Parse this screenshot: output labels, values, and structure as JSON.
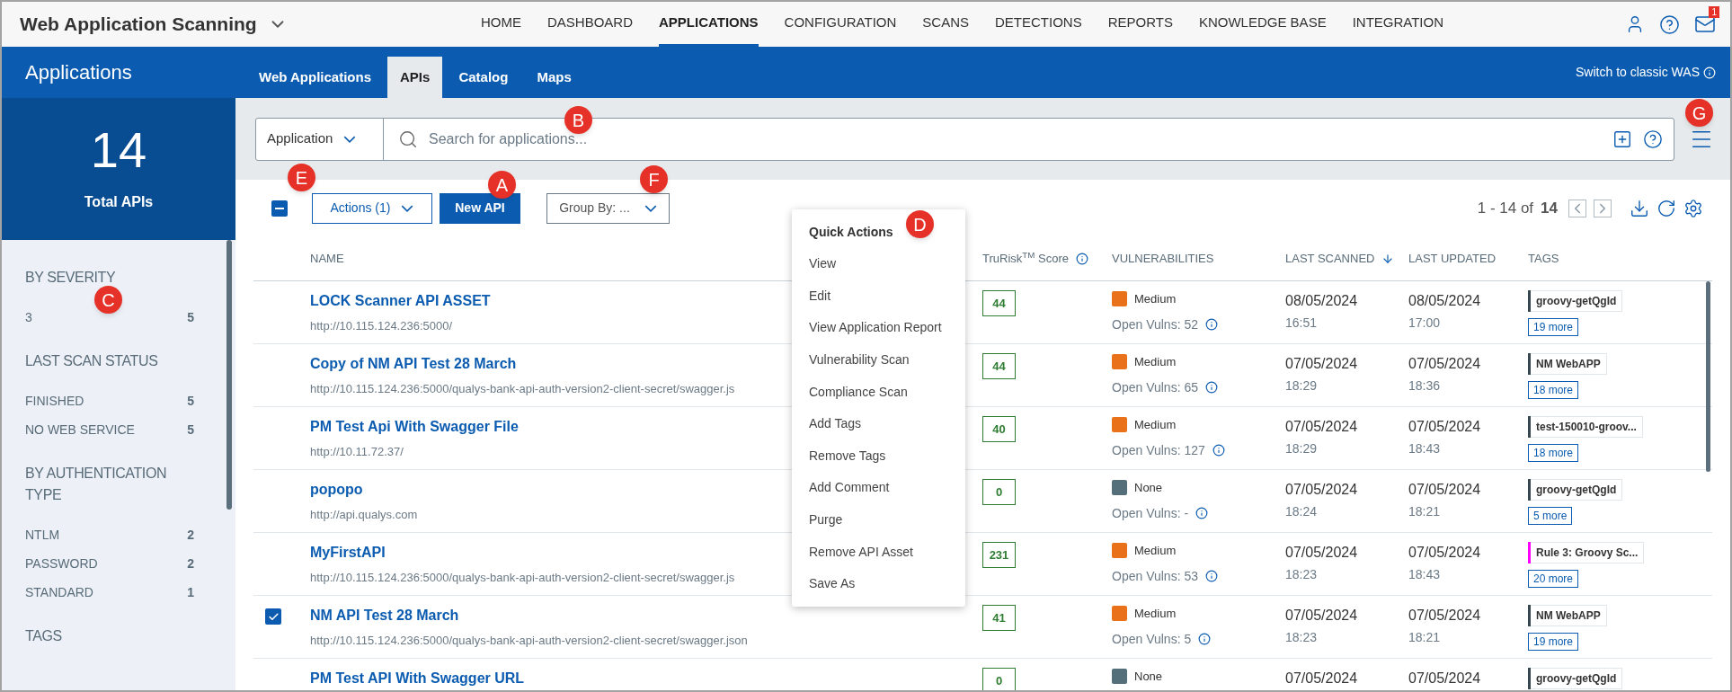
{
  "app_title": "Web Application Scanning",
  "nav": [
    {
      "label": "HOME",
      "selected": false
    },
    {
      "label": "DASHBOARD",
      "selected": false
    },
    {
      "label": "APPLICATIONS",
      "selected": true
    },
    {
      "label": "CONFIGURATION",
      "selected": false
    },
    {
      "label": "SCANS",
      "selected": false
    },
    {
      "label": "DETECTIONS",
      "selected": false
    },
    {
      "label": "REPORTS",
      "selected": false
    },
    {
      "label": "KNOWLEDGE BASE",
      "selected": false
    },
    {
      "label": "INTEGRATION",
      "selected": false
    }
  ],
  "notification_count": "1",
  "section_title": "Applications",
  "tabs": [
    {
      "label": "Web Applications",
      "selected": false
    },
    {
      "label": "APIs",
      "selected": true
    },
    {
      "label": "Catalog",
      "selected": false
    },
    {
      "label": "Maps",
      "selected": false
    }
  ],
  "switch_link": "Switch to classic WAS",
  "summary": {
    "count": "14",
    "label": "Total APIs"
  },
  "filters": [
    {
      "heading": "BY SEVERITY",
      "items": [
        {
          "label": "3",
          "count": "5"
        }
      ]
    },
    {
      "heading": "LAST SCAN STATUS",
      "items": [
        {
          "label": "FINISHED",
          "count": "5"
        },
        {
          "label": "NO WEB SERVICE",
          "count": "5"
        }
      ]
    },
    {
      "heading": "BY AUTHENTICATION TYPE",
      "items": [
        {
          "label": "NTLM",
          "count": "2"
        },
        {
          "label": "PASSWORD",
          "count": "2"
        },
        {
          "label": "STANDARD",
          "count": "1"
        }
      ]
    },
    {
      "heading": "TAGS"
    }
  ],
  "search": {
    "scope": "Application",
    "placeholder": "Search for applications..."
  },
  "toolbar": {
    "select_all_partial": true,
    "actions": "Actions (1)",
    "new_button": "New API",
    "group_by": "Group By: ...",
    "range": "1 - 14 of",
    "total": "14"
  },
  "columns": [
    {
      "label": "NAME",
      "sorted": false,
      "info": false
    },
    {
      "label": "TruRisk$^{TM}$ Score",
      "sorted": false,
      "info": true
    },
    {
      "label": "VULNERABILITIES",
      "sorted": false,
      "info": false
    },
    {
      "label": "LAST SCANNED",
      "sorted": true,
      "info": false
    },
    {
      "label": "LAST UPDATED",
      "sorted": false,
      "info": false
    },
    {
      "label": "TAGS",
      "sorted": false,
      "info": false
    }
  ],
  "rows": [
    {
      "checked": false,
      "name": "LOCK Scanner API ASSET",
      "url": "http://10.115.124.236:5000/",
      "score": "44",
      "severity": "Medium",
      "color": "#e8711a",
      "open_vulns": "Open Vulns: 52",
      "scanned_date": "08/05/2024",
      "scanned_time": "16:51",
      "updated_date": "08/05/2024",
      "updated_time": "17:00",
      "tag": {
        "label": "groovy-getQgId",
        "color": "#37474f"
      },
      "more": "19 more"
    },
    {
      "checked": false,
      "name": "Copy of NM API Test 28 March",
      "url": "http://10.115.124.236:5000/qualys-bank-api-auth-version2-client-secret/swagger.js",
      "score": "44",
      "severity": "Medium",
      "color": "#e8711a",
      "open_vulns": "Open Vulns: 65",
      "scanned_date": "07/05/2024",
      "scanned_time": "18:29",
      "updated_date": "07/05/2024",
      "updated_time": "18:36",
      "tag": {
        "label": "NM WebAPP",
        "color": "#37474f"
      },
      "more": "18 more"
    },
    {
      "checked": false,
      "name": "PM Test Api With Swagger File",
      "url": "http://10.11.72.37/",
      "score": "40",
      "severity": "Medium",
      "color": "#e8711a",
      "open_vulns": "Open Vulns: 127",
      "scanned_date": "07/05/2024",
      "scanned_time": "18:29",
      "updated_date": "07/05/2024",
      "updated_time": "18:43",
      "tag": {
        "label": "test-150010-groov...",
        "color": "#37474f"
      },
      "more": "18 more"
    },
    {
      "checked": false,
      "name": "popopo",
      "url": "http://api.qualys.com",
      "score": "0",
      "severity": "None",
      "color": "#546e7a",
      "open_vulns": "Open Vulns: -",
      "scanned_date": "07/05/2024",
      "scanned_time": "18:24",
      "updated_date": "07/05/2024",
      "updated_time": "18:21",
      "tag": {
        "label": "groovy-getQgId",
        "color": "#37474f"
      },
      "more": "5 more"
    },
    {
      "checked": false,
      "name": "MyFirstAPI",
      "url": "http://10.115.124.236:5000/qualys-bank-api-auth-version2-client-secret/swagger.js",
      "score": "231",
      "severity": "Medium",
      "color": "#e8711a",
      "open_vulns": "Open Vulns: 53",
      "scanned_date": "07/05/2024",
      "scanned_time": "18:23",
      "updated_date": "07/05/2024",
      "updated_time": "18:43",
      "tag": {
        "label": "Rule 3: Groovy Sc...",
        "color": "#ff00ff"
      },
      "more": "20 more"
    },
    {
      "checked": true,
      "name": "NM API Test 28 March",
      "url": "http://10.115.124.236:5000/qualys-bank-api-auth-version2-client-secret/swagger.json",
      "score": "41",
      "severity": "Medium",
      "color": "#e8711a",
      "open_vulns": "Open Vulns: 5",
      "scanned_date": "07/05/2024",
      "scanned_time": "18:23",
      "updated_date": "07/05/2024",
      "updated_time": "18:21",
      "tag": {
        "label": "NM WebAPP",
        "color": "#37474f"
      },
      "more": "19 more"
    },
    {
      "checked": false,
      "name": "PM Test API With Swagger URL",
      "score": "0",
      "severity": "None",
      "color": "#546e7a",
      "scanned_date": "07/05/2024",
      "updated_date": "07/05/2024",
      "tag": {
        "label": "groovy-getQgId",
        "color": "#37474f"
      }
    }
  ],
  "menu": {
    "title": "Quick Actions",
    "items": [
      "View",
      "Edit",
      "View Application Report",
      "Vulnerability Scan",
      "Compliance Scan",
      "Add Tags",
      "Remove Tags",
      "Add Comment",
      "Purge",
      "Remove API Asset",
      "Save As"
    ]
  },
  "callouts": {
    "new_button": "A",
    "search": "B",
    "filters": "C",
    "menu": "D",
    "select": "E",
    "group_by": "F",
    "menu_button": "G"
  }
}
